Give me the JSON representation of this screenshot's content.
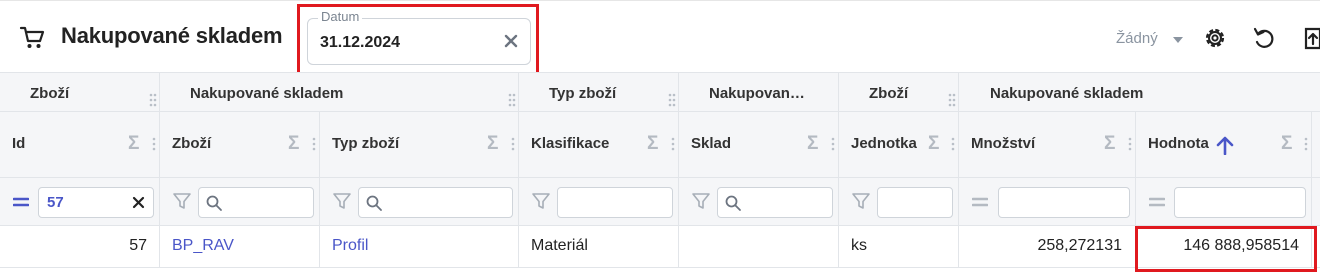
{
  "toolbar": {
    "title": "Nakupované skladem",
    "date_label": "Datum",
    "date_value": "31.12.2024",
    "none_select": "Žádný"
  },
  "groups": [
    {
      "label": "Zboží"
    },
    {
      "label": "Nakupované skladem"
    },
    {
      "label": "Typ zboží"
    },
    {
      "label": "Nakupovan…"
    },
    {
      "label": "Zboží"
    },
    {
      "label": "Nakupované skladem"
    }
  ],
  "columns": [
    {
      "label": "Id",
      "sum_icon": "Σ"
    },
    {
      "label": "Zboží",
      "sum_icon": "Σ"
    },
    {
      "label": "Typ zboží",
      "sum_icon": "Σ"
    },
    {
      "label": "Klasifikace",
      "sum_icon": "Σ"
    },
    {
      "label": "Sklad",
      "sum_icon": "Σ"
    },
    {
      "label": "Jednotka",
      "sum_icon": "Σ"
    },
    {
      "label": "Množství",
      "sum_icon": "Σ"
    },
    {
      "label": "Hodnota",
      "sum_icon": "Σ"
    }
  ],
  "filters": {
    "id_value": "57"
  },
  "row": {
    "id": "57",
    "zbozi": "BP_RAV",
    "typ_zbozi": "Profil",
    "klasifikace": "Materiál",
    "sklad": "",
    "jednotka": "ks",
    "mnozstvi": "258,272131",
    "hodnota": "146 888,958514"
  },
  "colors": {
    "accent": "#4a56c8",
    "highlight": "#e0191f",
    "header_bg": "#f5f6f8"
  },
  "icons": [
    "cart-icon",
    "clear-icon",
    "chevron-down-icon",
    "gear-icon",
    "undo-icon",
    "export-icon",
    "filter-icon",
    "search-icon",
    "equals-icon",
    "sort-up-icon",
    "grip-icon"
  ]
}
